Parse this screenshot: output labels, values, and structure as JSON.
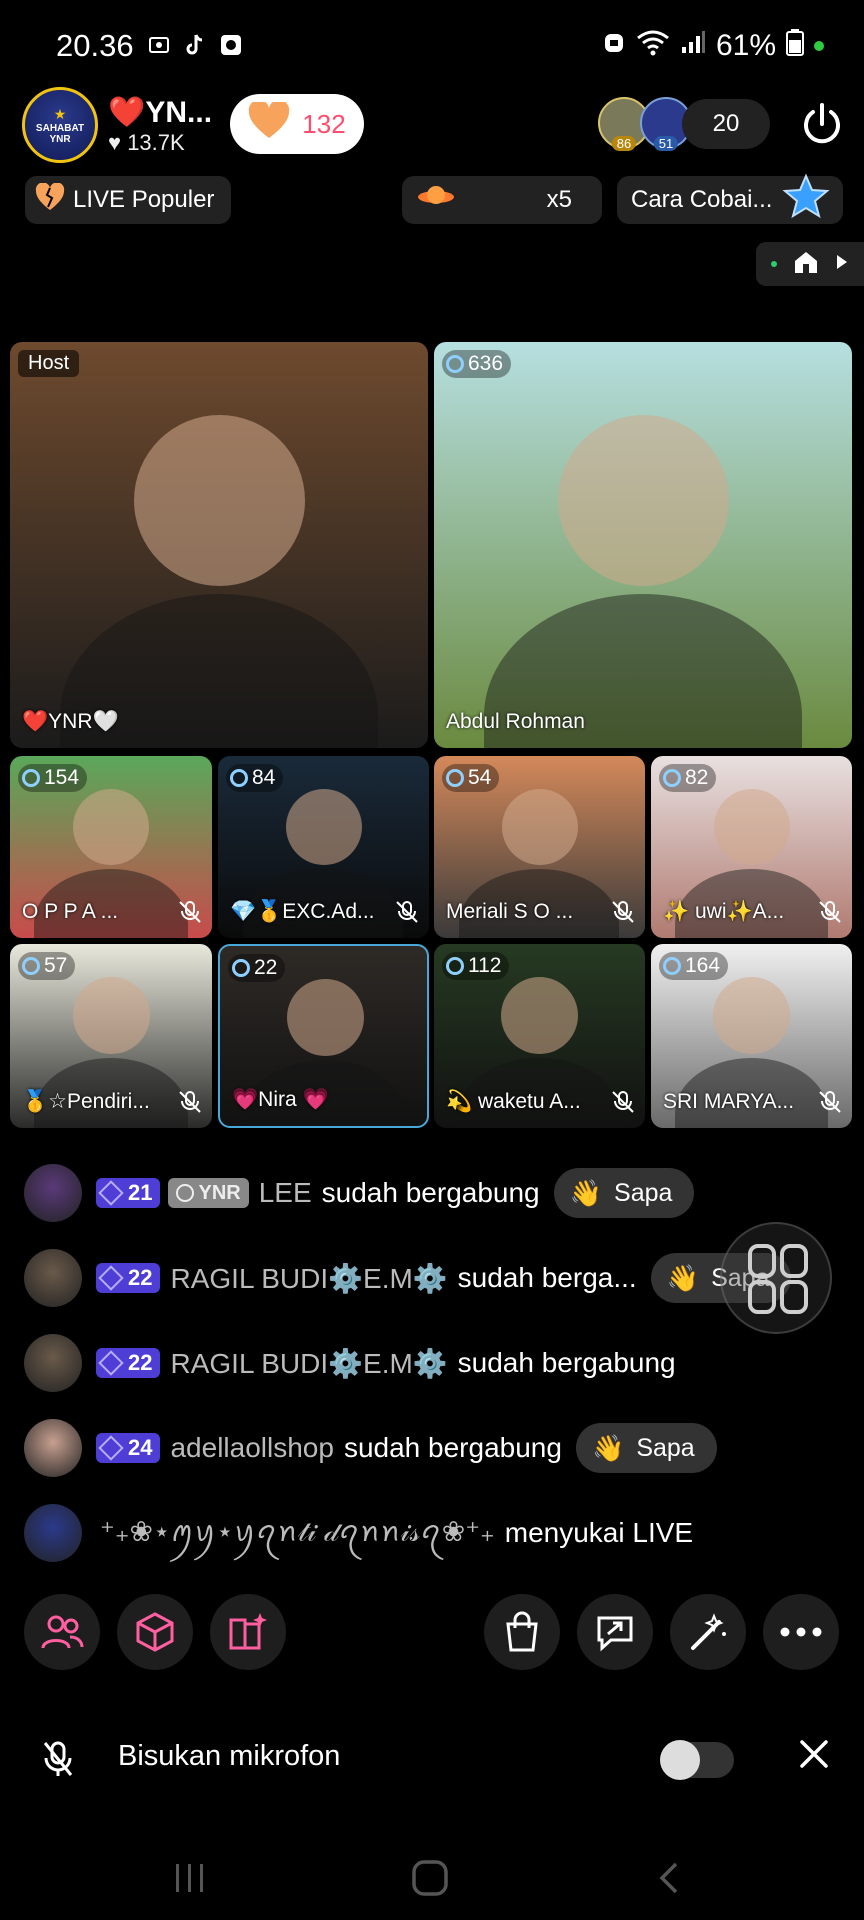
{
  "status_bar": {
    "time": "20.36",
    "battery": "61%",
    "icons_left": [
      "screenshot-icon",
      "tiktok-icon",
      "square-app-icon"
    ],
    "icons_right": [
      "alarm-icon",
      "wifi-icon",
      "signal-icon",
      "battery-icon"
    ]
  },
  "header": {
    "host_avatar_text": "SAHABAT YNR",
    "host_name": "❤️YN...",
    "host_likes": "13.7K",
    "like_count": "132",
    "viewer_badges": [
      "86",
      "51"
    ],
    "viewer_count": "20"
  },
  "chips": {
    "populer": "LIVE Populer",
    "multiplier": "x5",
    "cara": "Cara Cobai..."
  },
  "tiles": [
    {
      "label_host": "Host",
      "name": "❤️YNR🤍",
      "colors": [
        "#6e4a2e",
        "#1b1b1b"
      ]
    },
    {
      "count": "636",
      "name": "Abdul Rohman",
      "colors": [
        "#b6dfe0",
        "#6a8a3f"
      ]
    },
    {
      "count": "154",
      "name": "O P P A ...",
      "colors": [
        "#5aa85a",
        "#c84b4b"
      ]
    },
    {
      "count": "84",
      "name": "💎🥇EXC.Ad...",
      "colors": [
        "#1a2a3a",
        "#0a0a0a"
      ]
    },
    {
      "count": "54",
      "name": "Meriali  S O ...",
      "colors": [
        "#d4895a",
        "#3a3a3a"
      ]
    },
    {
      "count": "82",
      "name": "✨ uwi✨A...",
      "colors": [
        "#e8e0e0",
        "#b07a70"
      ]
    },
    {
      "count": "57",
      "name": "🥇☆Pendiri...",
      "colors": [
        "#e8e8dc",
        "#2a2a2a"
      ]
    },
    {
      "count": "22",
      "name": "💗Nira 💗",
      "colors": [
        "#2e2a26",
        "#111"
      ]
    },
    {
      "count": "112",
      "name": "💫 waketu A...",
      "colors": [
        "#263a22",
        "#111"
      ]
    },
    {
      "count": "164",
      "name": "SRI MARYA...",
      "colors": [
        "#f0f0f0",
        "#6a6a6a"
      ]
    }
  ],
  "chat": [
    {
      "level": "21",
      "fan_badge": "YNR",
      "user": "LEE",
      "message": "sudah bergabung",
      "action": "Sapa"
    },
    {
      "level": "22",
      "user": "RAGIL BUDI⚙️E.M⚙️",
      "message": "sudah berga...",
      "action": "Sapa"
    },
    {
      "level": "22",
      "user": "RAGIL BUDI⚙️E.M⚙️",
      "message": "sudah bergabung"
    },
    {
      "level": "24",
      "user": "adellaollshop",
      "message": "sudah bergabung",
      "action": "Sapa"
    },
    {
      "user": "⁺₊❀⋆ꪑꪗ⋆ꪗꪖꪀ𝓉𝒾 𝒹ꪖꪀꪀ𝒾𝓈ꪖ❀⁺₊",
      "message": "menyukai LIVE"
    }
  ],
  "toolbar": [
    "users-icon",
    "cube-icon",
    "book-spark-icon",
    "shopping-bag-icon",
    "share-comment-icon",
    "magic-wand-icon",
    "more-icon"
  ],
  "mute_bar": {
    "label": "Bisukan mikrofon",
    "toggle_on": false
  },
  "colors": {
    "level_badge": "#4e3ed6",
    "accent_pink": "#ff4d6d",
    "toolbar_icon": "#ff5fa0"
  }
}
